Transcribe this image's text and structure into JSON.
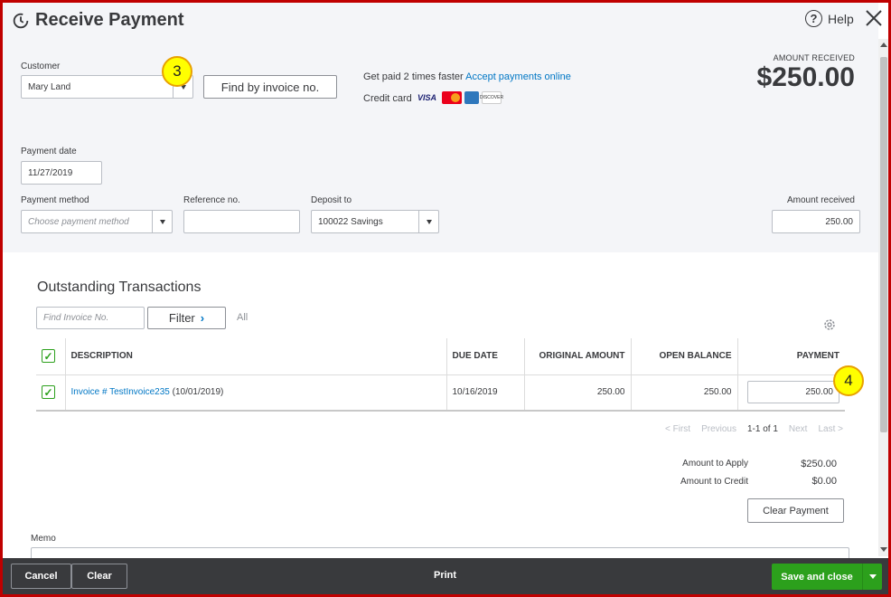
{
  "window": {
    "title": "Receive Payment",
    "help_label": "Help"
  },
  "customer": {
    "label": "Customer",
    "value": "Mary Land",
    "find_button": "Find by invoice no."
  },
  "online": {
    "text": "Get paid 2 times faster",
    "link": "Accept payments online",
    "credit_label": "Credit card",
    "cards": [
      "VISA",
      "MasterCard",
      "Amex",
      "DISCOVER"
    ]
  },
  "amount_received": {
    "label": "AMOUNT RECEIVED",
    "value": "$250.00"
  },
  "payment_date": {
    "label": "Payment date",
    "value": "11/27/2019"
  },
  "payment_method": {
    "label": "Payment method",
    "placeholder": "Choose payment method"
  },
  "reference": {
    "label": "Reference no.",
    "value": ""
  },
  "deposit": {
    "label": "Deposit to",
    "value": "100022 Savings"
  },
  "amount_field": {
    "label": "Amount received",
    "value": "250.00"
  },
  "markers": {
    "m3": "3",
    "m4": "4"
  },
  "outstanding": {
    "title": "Outstanding Transactions",
    "search_placeholder": "Find Invoice No.",
    "filter_label": "Filter",
    "all_label": "All",
    "columns": [
      "DESCRIPTION",
      "DUE DATE",
      "ORIGINAL AMOUNT",
      "OPEN BALANCE",
      "PAYMENT"
    ],
    "rows": [
      {
        "invoice_link": "Invoice # TestInvoice235",
        "invoice_date": "(10/01/2019)",
        "due_date": "10/16/2019",
        "original": "250.00",
        "open": "250.00",
        "payment": "250.00"
      }
    ]
  },
  "pager": {
    "first": "< First",
    "previous": "Previous",
    "range": "1-1 of 1",
    "next": "Next",
    "last": "Last >"
  },
  "totals": {
    "apply_label": "Amount to Apply",
    "apply_value": "$250.00",
    "credit_label": "Amount to Credit",
    "credit_value": "$0.00",
    "clear_button": "Clear Payment"
  },
  "memo": {
    "label": "Memo"
  },
  "footer": {
    "cancel": "Cancel",
    "clear": "Clear",
    "print": "Print",
    "save_close": "Save and close"
  },
  "colors": {
    "accent": "#2ca01c",
    "link": "#0077c5",
    "frame": "#c00000",
    "footer": "#393a3d"
  }
}
